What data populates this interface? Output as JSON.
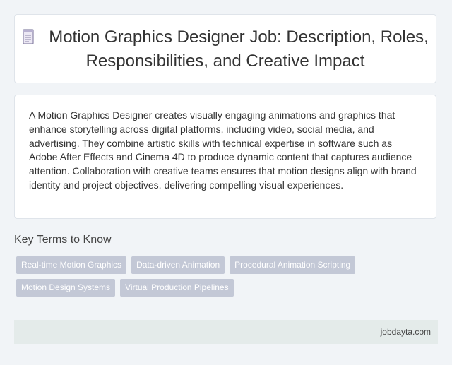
{
  "header": {
    "icon": "document-icon",
    "title": "Motion Graphics Designer Job: Description, Roles, Responsibilities, and Creative Impact"
  },
  "summary": {
    "text": "A Motion Graphics Designer creates visually engaging animations and graphics that enhance storytelling across digital platforms, including video, social media, and advertising. They combine artistic skills with technical expertise in software such as Adobe After Effects and Cinema 4D to produce dynamic content that captures audience attention. Collaboration with creative teams ensures that motion designs align with brand identity and project objectives, delivering compelling visual experiences."
  },
  "key_terms": {
    "heading": "Key Terms to Know",
    "tags": [
      "Real-time Motion Graphics",
      "Data-driven Animation",
      "Procedural Animation Scripting",
      "Motion Design Systems",
      "Virtual Production Pipelines"
    ]
  },
  "footer": {
    "site": "jobdayta.com"
  },
  "colors": {
    "background": "#f1f4f7",
    "tag_background": "#c3c8d6",
    "footer_background": "#e4ebea"
  }
}
